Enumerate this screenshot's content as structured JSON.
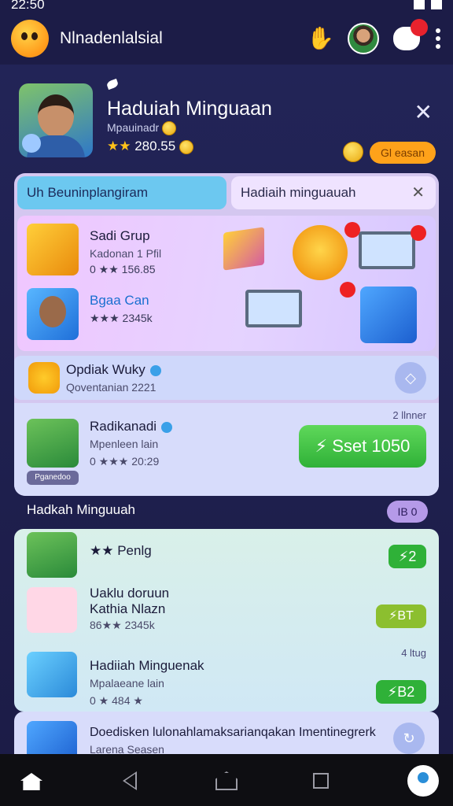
{
  "status": {
    "time": "22:50"
  },
  "app": {
    "title": "Nlnadenlalsial",
    "notification_count": ""
  },
  "header": {
    "title": "Haduiah Minguaan",
    "subtitle": "Mpauinadr",
    "score": "280.55",
    "pill": "Gl easan"
  },
  "tabs": [
    {
      "label": "Uh Beuninplangiram"
    },
    {
      "label": "Hadiaih minguauah"
    }
  ],
  "feature": {
    "rows": [
      {
        "name": "Sadi Grup",
        "sub": "Kadonan 1 Pfil",
        "stats": "0 ★★ 156.85"
      },
      {
        "name": "Bgaa Can",
        "stats": "★★★ 2345k"
      }
    ]
  },
  "items": [
    {
      "name": "Opdiak Wuky",
      "sub": "Qoventanian 2221"
    },
    {
      "name": "Radikanadi",
      "sub": "Mpenleen lain",
      "stats": "0 ★★★ 20:29",
      "time": "2 llnner",
      "tag": "Pganedoo",
      "cta": "Sset 1050"
    }
  ],
  "section": {
    "title": "Hadkah Minguuah",
    "pill": "IB 0"
  },
  "list": [
    {
      "name": "★★ Penlg",
      "badge": "2"
    },
    {
      "name": "Uaklu doruun",
      "sub": "Kathia Nlazn",
      "stats": "86★★ 2345k",
      "badge": "BT"
    },
    {
      "name": "Hadiiah Minguenak",
      "sub": "Mpalaeane lain",
      "stats": "0 ★ 484 ★",
      "time": "4 ltug",
      "badge": "B2"
    },
    {
      "name": "Doedisken lulonahlamaksarianqakan Imentinegrerk",
      "sub": "Larena Seasen"
    }
  ],
  "colors": {
    "accent_green": "#2fb138",
    "accent_orange": "#ffa21a",
    "tab_active": "#6cc8f0"
  }
}
